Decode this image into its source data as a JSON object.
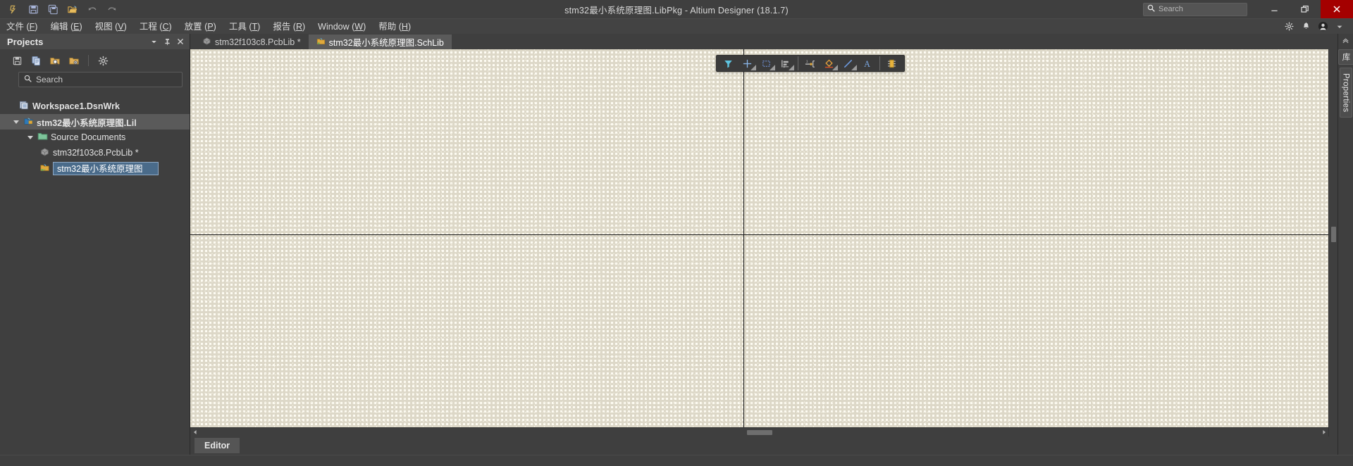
{
  "window": {
    "title": "stm32最小系统原理图.LibPkg - Altium Designer (18.1.7)",
    "minimize_label": "—",
    "restore_label": "❐",
    "close_label": "✕"
  },
  "titlebar_tools": [
    {
      "name": "altium-logo-icon",
      "label": "Altium"
    },
    {
      "name": "save-icon",
      "label": "Save"
    },
    {
      "name": "save-all-icon",
      "label": "Save All"
    },
    {
      "name": "open-folder-icon",
      "label": "Open"
    },
    {
      "name": "undo-icon",
      "label": "Undo"
    },
    {
      "name": "redo-icon",
      "label": "Redo"
    }
  ],
  "search": {
    "placeholder": "Search",
    "value": ""
  },
  "menubar": {
    "items": [
      {
        "label": "文件",
        "accel": "F"
      },
      {
        "label": "编辑",
        "accel": "E"
      },
      {
        "label": "视图",
        "accel": "V"
      },
      {
        "label": "工程",
        "accel": "C"
      },
      {
        "label": "放置",
        "accel": "P"
      },
      {
        "label": "工具",
        "accel": "T"
      },
      {
        "label": "报告",
        "accel": "R"
      },
      {
        "label": "Window",
        "accel": "W"
      },
      {
        "label": "帮助",
        "accel": "H"
      }
    ],
    "right_icons": [
      {
        "name": "gear-icon"
      },
      {
        "name": "bell-icon"
      },
      {
        "name": "user-avatar-icon"
      },
      {
        "name": "chevron-down-icon"
      }
    ]
  },
  "projects_panel": {
    "title": "Projects",
    "header_buttons": [
      {
        "name": "panel-menu-dropdown",
        "glyph": "▼"
      },
      {
        "name": "panel-pin-button",
        "glyph": "⚲"
      },
      {
        "name": "panel-close-button",
        "glyph": "✕"
      }
    ],
    "toolbar": [
      {
        "name": "save-project-icon",
        "label": "Save"
      },
      {
        "name": "copy-documents-icon",
        "label": "Copy"
      },
      {
        "name": "folder-search-icon",
        "label": "Browse"
      },
      {
        "name": "folder-options-icon",
        "label": "Project Options"
      },
      {
        "name": "project-settings-gear-icon",
        "label": "Settings"
      }
    ],
    "search": {
      "placeholder": "Search",
      "value": ""
    },
    "tree": {
      "workspace": "Workspace1.DsnWrk",
      "project": "stm32最小系统原理图.Lil",
      "folder": "Source Documents",
      "documents": [
        {
          "label": "stm32f103c8.PcbLib *",
          "icon": "pcblib-icon",
          "modified": true
        },
        {
          "label": "stm32最小系统原理图",
          "icon": "schlib-icon",
          "editing": true
        }
      ]
    }
  },
  "doc_tabs": [
    {
      "label": "stm32f103c8.PcbLib *",
      "icon": "pcblib-icon",
      "active": false
    },
    {
      "label": "stm32最小系统原理图.SchLib",
      "icon": "schlib-icon",
      "active": true
    }
  ],
  "float_toolbar": [
    {
      "name": "filter-icon",
      "label": "Filter"
    },
    {
      "name": "crosshair-place-icon",
      "label": "Place"
    },
    {
      "name": "selection-rectangle-icon",
      "label": "Select"
    },
    {
      "name": "align-icon",
      "label": "Align"
    },
    {
      "name": "place-pin-icon",
      "label": "Place Pin"
    },
    {
      "name": "place-polygon-icon",
      "label": "Place Polygon"
    },
    {
      "name": "place-line-icon",
      "label": "Place Line"
    },
    {
      "name": "place-text-icon",
      "label": "Place Text"
    },
    {
      "name": "place-component-icon",
      "label": "Place Component"
    }
  ],
  "bottom_tabs": [
    {
      "label": "Editor",
      "active": true
    }
  ],
  "right_dock": {
    "collapse_glyph": "«",
    "tabs": [
      {
        "label": "库",
        "name": "library-panel-tab"
      },
      {
        "label": "Properties",
        "name": "properties-panel-tab"
      }
    ]
  },
  "colors": {
    "canvas_background": "#fdfbf2",
    "grid_line": "#ddd8c8",
    "axis": "#111111",
    "chrome": "#3f3f3f",
    "accent_blue": "#4a9ede",
    "close_red": "#a40000"
  }
}
